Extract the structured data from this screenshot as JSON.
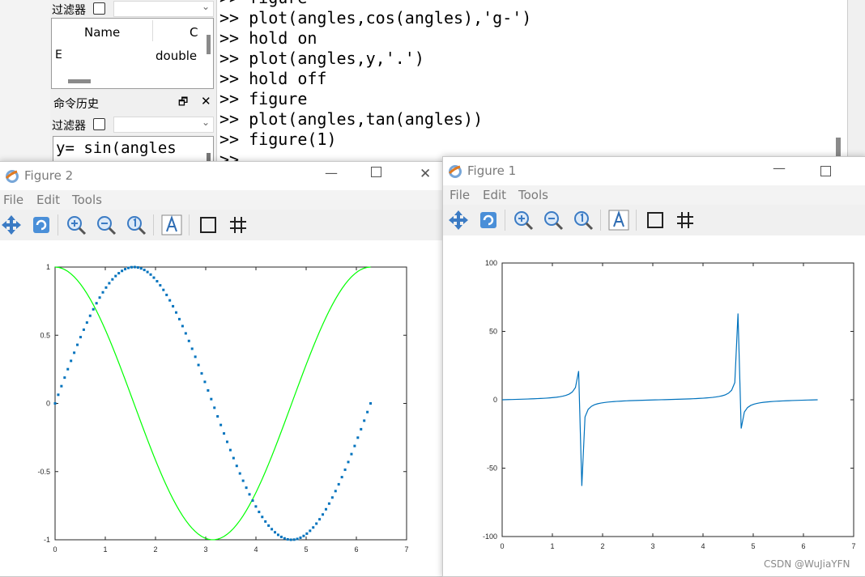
{
  "left_panel": {
    "filter_label": "过滤器",
    "workspace": {
      "col_name": "Name",
      "col_class": "C",
      "rows": [
        {
          "name": "E",
          "class": "double"
        }
      ]
    },
    "history_title": "命令历史",
    "history_entry": "y= sin(angles"
  },
  "console": {
    "lines": [
      ">> figure",
      ">> plot(angles,cos(angles),'g-')",
      ">> hold on",
      ">> plot(angles,y,'.')",
      ">> hold off",
      ">> figure",
      ">> plot(angles,tan(angles))",
      ">> figure(1)",
      ">> "
    ]
  },
  "figures": [
    {
      "title": "Figure 2",
      "menu": [
        "File",
        "Edit",
        "Tools"
      ],
      "chart_data": {
        "type": "line",
        "xlim": [
          0,
          7
        ],
        "ylim": [
          -1,
          1
        ],
        "xticks": [
          0,
          1,
          2,
          3,
          4,
          5,
          6,
          7
        ],
        "yticks": [
          -1,
          -0.5,
          0,
          0.5,
          1
        ],
        "grid": false,
        "series": [
          {
            "function": "cos",
            "style": "solid line",
            "color": "#00ff00",
            "x_range": [
              0,
              6.2832
            ],
            "points": 100
          },
          {
            "function": "sin",
            "style": "dot markers",
            "color": "#0072bd",
            "x_range": [
              0,
              6.2832
            ],
            "points": 100
          }
        ]
      }
    },
    {
      "title": "Figure 1",
      "menu": [
        "File",
        "Edit",
        "Tools"
      ],
      "chart_data": {
        "type": "line",
        "xlim": [
          0,
          7
        ],
        "ylim": [
          -100,
          100
        ],
        "xticks": [
          0,
          1,
          2,
          3,
          4,
          5,
          6,
          7
        ],
        "yticks": [
          -100,
          -50,
          0,
          50,
          100
        ],
        "grid": false,
        "series": [
          {
            "function": "tan",
            "style": "solid line",
            "color": "#0072bd",
            "x_range": [
              0,
              6.2832
            ],
            "points": 100
          }
        ]
      }
    }
  ],
  "watermark": "CSDN @WuJiaYFN",
  "icons": [
    "pan-icon",
    "rotate-icon",
    "zoom-in-icon",
    "zoom-out-icon",
    "zoom-reset-icon",
    "text-icon",
    "box-icon",
    "grid-icon"
  ]
}
